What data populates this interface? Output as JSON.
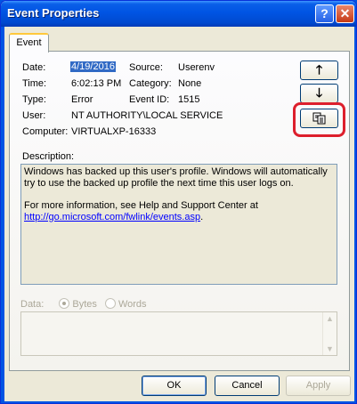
{
  "window": {
    "title": "Event Properties",
    "help_glyph": "?",
    "close_glyph": "✕"
  },
  "tabs": [
    {
      "label": "Event"
    }
  ],
  "event": {
    "date_label": "Date:",
    "date": "4/19/2016",
    "time_label": "Time:",
    "time": "6:02:13 PM",
    "type_label": "Type:",
    "type": "Error",
    "user_label": "User:",
    "user": "NT AUTHORITY\\LOCAL SERVICE",
    "computer_label": "Computer:",
    "computer": "VIRTUALXP-16333",
    "source_label": "Source:",
    "source": "Userenv",
    "category_label": "Category:",
    "category": "None",
    "event_id_label": "Event ID:",
    "event_id": "1515"
  },
  "side_buttons": {
    "up": "🡑",
    "down": "🡓",
    "copy": "copy-icon"
  },
  "description": {
    "label": "Description:",
    "line1": "Windows has backed up this user's profile. Windows will automatically try to use the backed up profile the next time this user logs on.",
    "line2": "For more information, see Help and Support Center at",
    "link": "http://go.microsoft.com/fwlink/events.asp",
    "link_suffix": "."
  },
  "data": {
    "label": "Data:",
    "bytes": "Bytes",
    "words": "Words",
    "selected": "Bytes"
  },
  "buttons": {
    "ok": "OK",
    "cancel": "Cancel",
    "apply": "Apply"
  },
  "colors": {
    "titlebar": "#0054e3",
    "selection": "#316ac5",
    "highlight_box": "#dd1f2c"
  }
}
